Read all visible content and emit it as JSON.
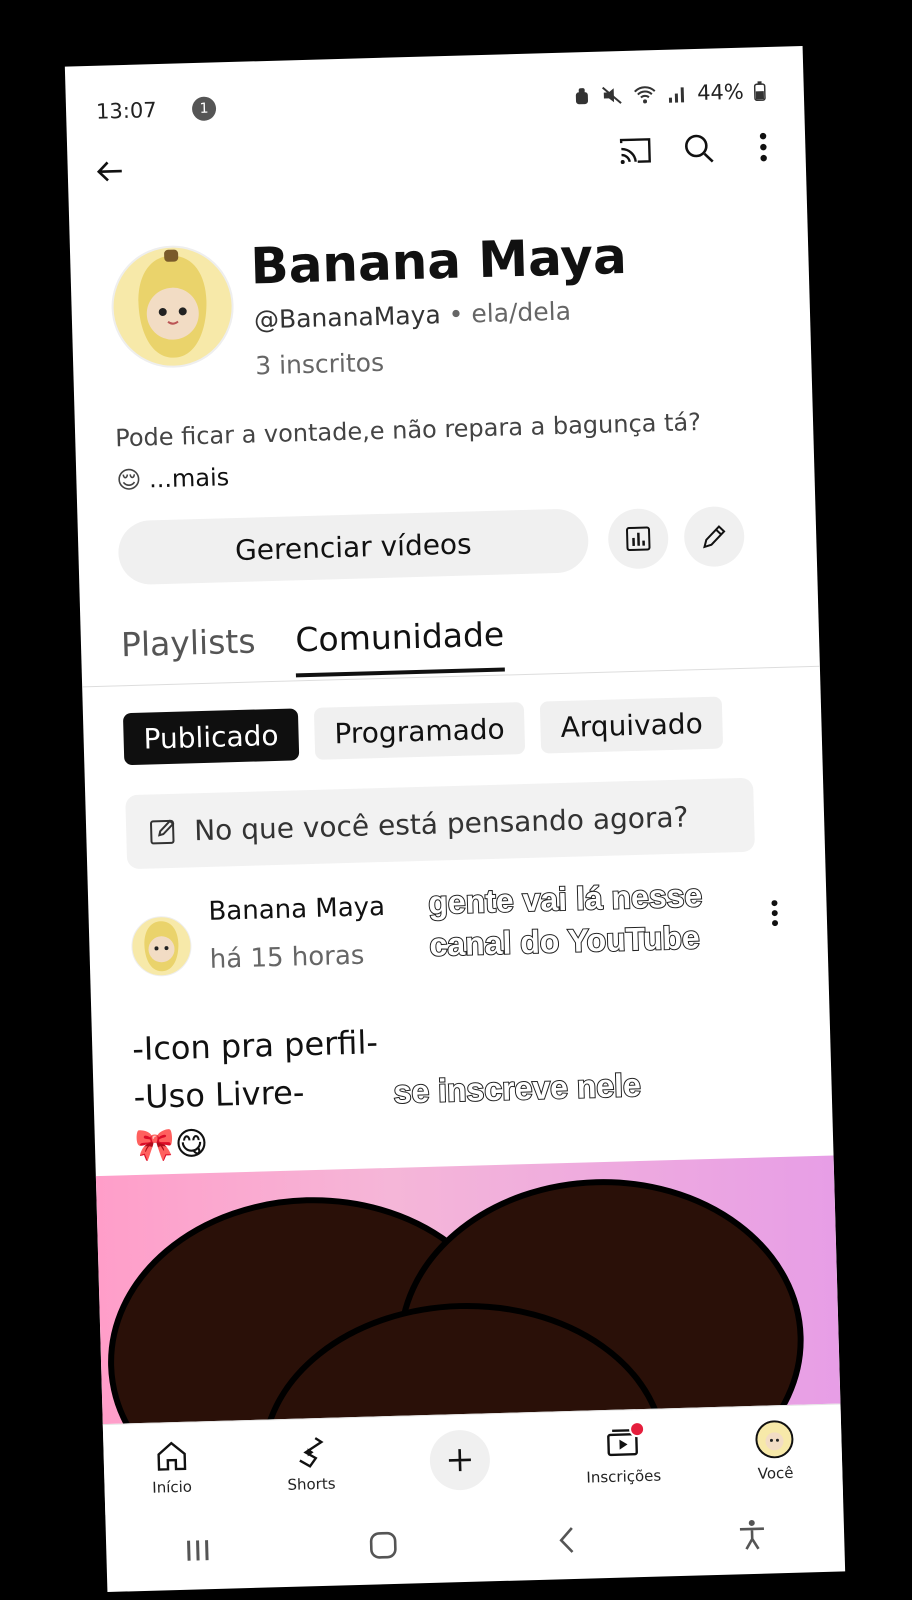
{
  "status_bar": {
    "time": "13:07",
    "notification_count": "1",
    "battery": "44%",
    "icons": [
      "silent-icon",
      "mute-icon",
      "wifi-icon",
      "signal-icon",
      "battery-icon"
    ]
  },
  "top_bar": {
    "icons": [
      "back-arrow-icon",
      "cast-icon",
      "search-icon",
      "more-vert-icon"
    ]
  },
  "channel": {
    "name": "Banana Maya",
    "handle": "@BananaMaya",
    "separator": "•",
    "pronouns": "ela/dela",
    "subscribers": "3 inscritos",
    "description": "Pode ficar a vontade,e não repara a bagunça tá? 😌",
    "more_label": "...mais",
    "manage_button": "Gerenciar vídeos"
  },
  "tabs": [
    {
      "label": "Playlists",
      "active": false
    },
    {
      "label": "Comunidade",
      "active": true
    }
  ],
  "chips": [
    {
      "label": "Publicado",
      "active": true
    },
    {
      "label": "Programado",
      "active": false
    },
    {
      "label": "Arquivado",
      "active": false
    }
  ],
  "composer": {
    "placeholder": "No que você está pensando agora?"
  },
  "post": {
    "author": "Banana Maya",
    "time": "há 15 horas",
    "line1": "-Icon pra perfil-",
    "line2": "-Uso Livre-",
    "emojis": "🎀😋"
  },
  "overlay": {
    "caption1_line1": "gente vai lá nesse",
    "caption1_line2": "canal do YouTube",
    "caption2": "se inscreve nele"
  },
  "bottom_nav": [
    {
      "label": "Início",
      "icon": "home-icon"
    },
    {
      "label": "Shorts",
      "icon": "shorts-icon"
    },
    {
      "label": "",
      "icon": "create-plus-icon"
    },
    {
      "label": "Inscrições",
      "icon": "subscriptions-icon"
    },
    {
      "label": "Você",
      "icon": "avatar-icon"
    }
  ],
  "colors": {
    "chip_active_bg": "#0f0f0f",
    "button_bg": "#f0f0f0",
    "notification_dot": "#e51e3c"
  }
}
